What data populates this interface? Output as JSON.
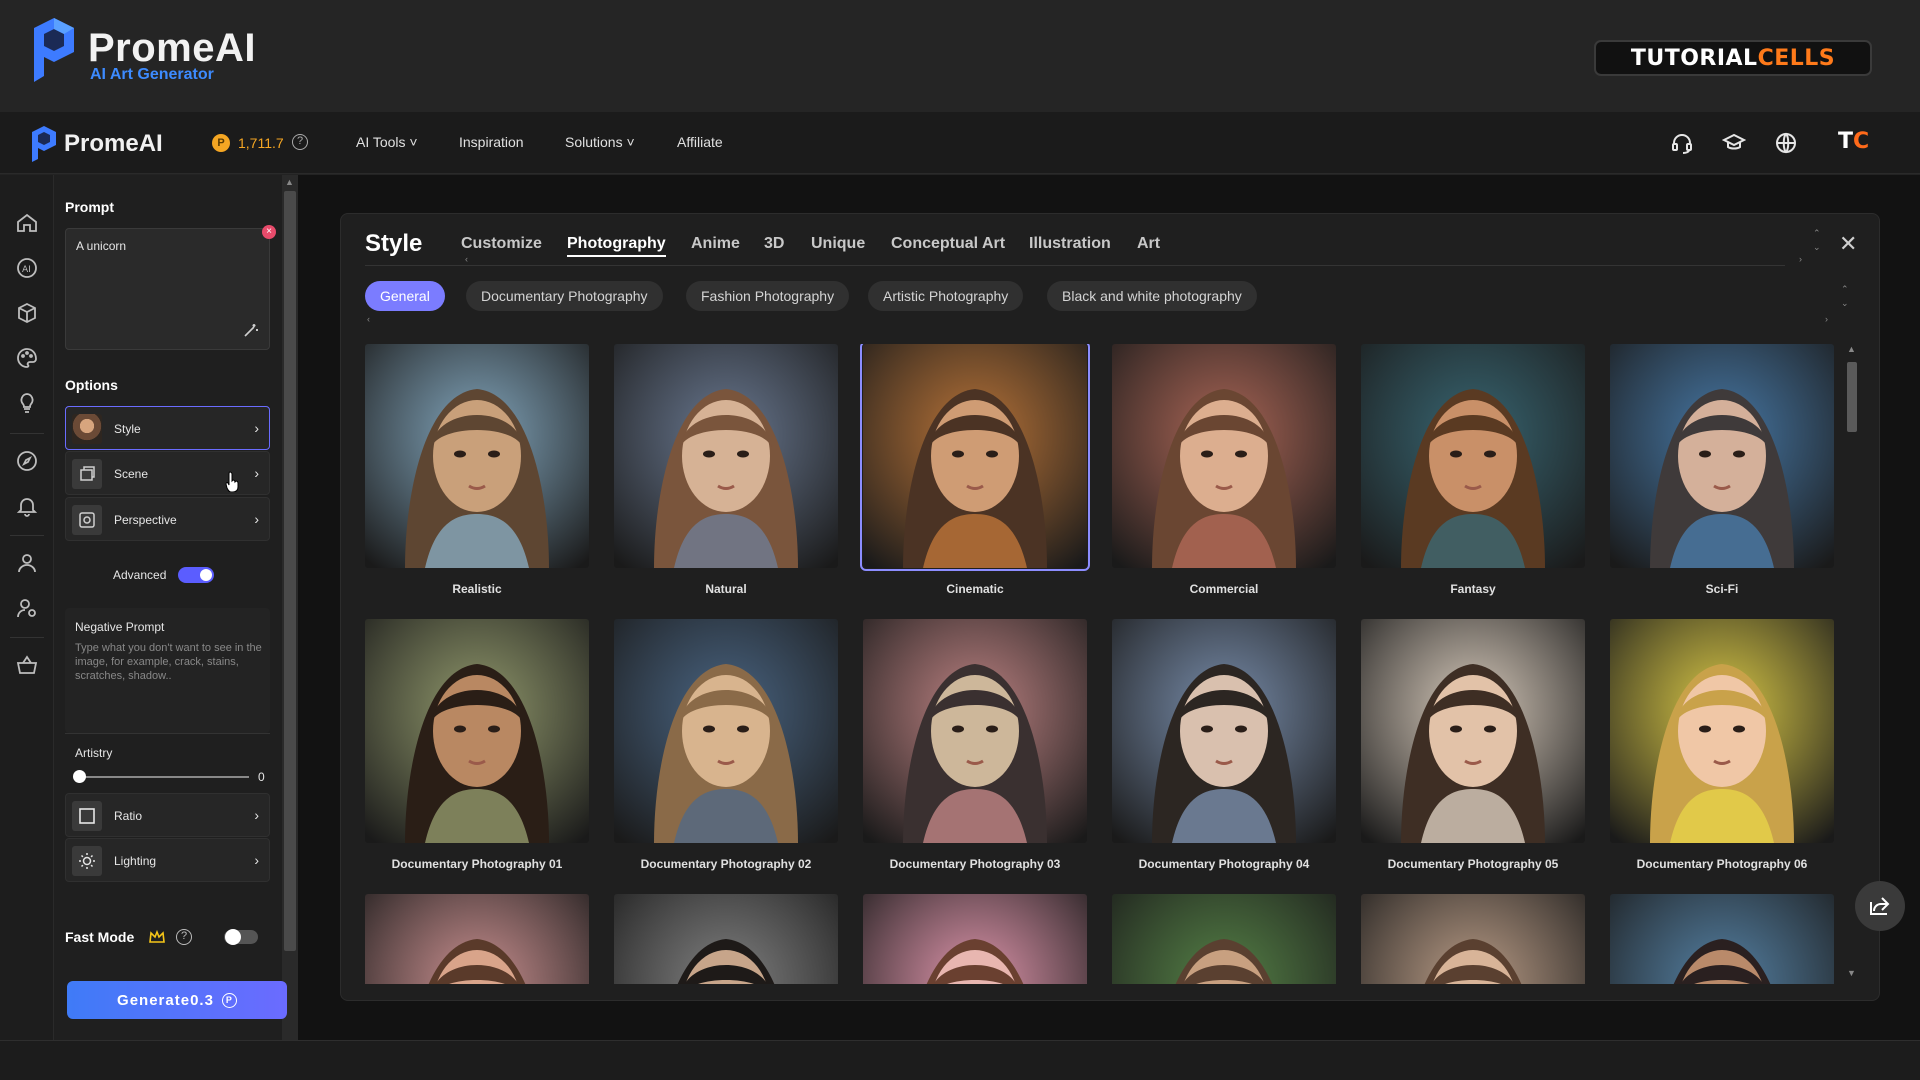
{
  "banner": {
    "brand_name": "PromeAI",
    "brand_subtitle": "AI Art Generator",
    "badge_part1": "TUTORIAL",
    "badge_part2": "CELLS"
  },
  "topnav": {
    "brand": "PromeAI",
    "credits": "1,711.7",
    "help": "?",
    "items": [
      "AI Tools ˅",
      "Inspiration",
      "Solutions ˅",
      "Affiliate"
    ],
    "icons": [
      "headset-icon",
      "graduation-cap-icon",
      "globe-icon"
    ],
    "avatar_part1": "T",
    "avatar_part2": "C"
  },
  "rail": {
    "icons": [
      "home-icon",
      "ai-icon",
      "cube-icon",
      "palette-icon",
      "bulb-icon",
      "compass-icon",
      "bell-icon",
      "user-icon",
      "user-settings-icon",
      "basket-icon"
    ]
  },
  "panel": {
    "prompt_title": "Prompt",
    "prompt_value": "A unicorn",
    "options_title": "Options",
    "options": [
      {
        "label": "Style",
        "icon": "style-thumb"
      },
      {
        "label": "Scene",
        "icon": "scene-icon"
      },
      {
        "label": "Perspective",
        "icon": "perspective-icon"
      }
    ],
    "advanced_label": "Advanced",
    "negative_title": "Negative Prompt",
    "negative_placeholder": "Type what you don't want to see in the image, for example, crack, stains, scratches, shadow..",
    "artistry_label": "Artistry",
    "artistry_value": "0",
    "bottom_options": [
      {
        "label": "Ratio",
        "icon": "ratio-icon"
      },
      {
        "label": "Lighting",
        "icon": "lighting-icon"
      }
    ],
    "fast_mode_label": "Fast Mode",
    "generate_label": "Generate0.3"
  },
  "modal": {
    "title": "Style",
    "tabs": [
      "Customize",
      "Photography",
      "Anime",
      "3D",
      "Unique",
      "Conceptual Art",
      "Illustration",
      "Art"
    ],
    "active_tab": "Photography",
    "chips": [
      "General",
      "Documentary Photography",
      "Fashion Photography",
      "Artistic Photography",
      "Black and white photography"
    ],
    "active_chip": "General",
    "cards": [
      {
        "label": "Realistic"
      },
      {
        "label": "Natural"
      },
      {
        "label": "Cinematic"
      },
      {
        "label": "Commercial"
      },
      {
        "label": "Fantasy"
      },
      {
        "label": "Sci-Fi"
      },
      {
        "label": "Documentary Photography 01"
      },
      {
        "label": "Documentary Photography 02"
      },
      {
        "label": "Documentary Photography 03"
      },
      {
        "label": "Documentary Photography 04"
      },
      {
        "label": "Documentary Photography 05"
      },
      {
        "label": "Documentary Photography 06"
      },
      {
        "label": ""
      },
      {
        "label": ""
      },
      {
        "label": ""
      },
      {
        "label": ""
      },
      {
        "label": ""
      },
      {
        "label": ""
      }
    ],
    "selected_card": "Cinematic"
  },
  "colors": {
    "accent": "#7b7cff",
    "brand_blue": "#3d8bff",
    "credits": "#f5a623",
    "badge_orange": "#ff7a1a"
  }
}
